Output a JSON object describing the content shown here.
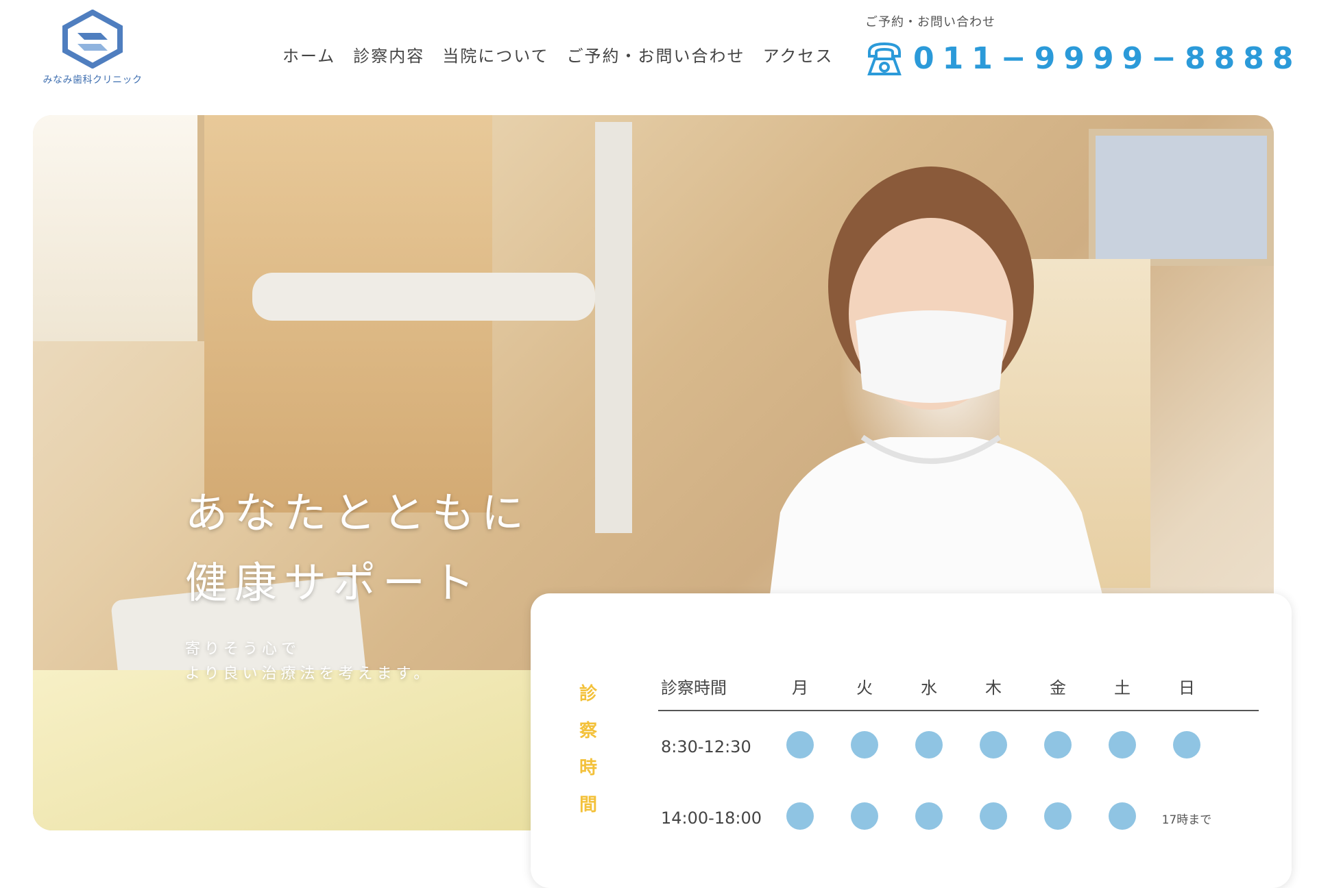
{
  "brand": {
    "name": "みなみ歯科クリニック",
    "logo_color": "#4f7ebf"
  },
  "nav": {
    "items": [
      {
        "label": "ホーム"
      },
      {
        "label": "診察内容"
      },
      {
        "label": "当院について"
      },
      {
        "label": "ご予約・お問い合わせ"
      },
      {
        "label": "アクセス"
      }
    ]
  },
  "contact": {
    "label": "ご予約・お問い合わせ",
    "phone": "011−9999−8888",
    "icon": "telephone-icon",
    "accent_color": "#2b9ad9"
  },
  "hero": {
    "title_line1": "あなたとともに",
    "title_line2": "健康サポート",
    "subtitle_line1": "寄りそう心で",
    "subtitle_line2": "より良い治療法を考えます。"
  },
  "schedule": {
    "vertical_label": [
      "診",
      "察",
      "時",
      "間"
    ],
    "label_color": "#f3c13a",
    "dot_color": "#8fc4e3",
    "header": {
      "time": "診察時間",
      "days": [
        "月",
        "火",
        "水",
        "木",
        "金",
        "土",
        "日"
      ]
    },
    "rows": [
      {
        "time": "8:30-12:30",
        "days": [
          true,
          true,
          true,
          true,
          true,
          true,
          true
        ]
      },
      {
        "time": "14:00-18:00",
        "days": [
          true,
          true,
          true,
          true,
          true,
          true,
          false
        ],
        "sunday_note": "17時まで"
      }
    ]
  }
}
